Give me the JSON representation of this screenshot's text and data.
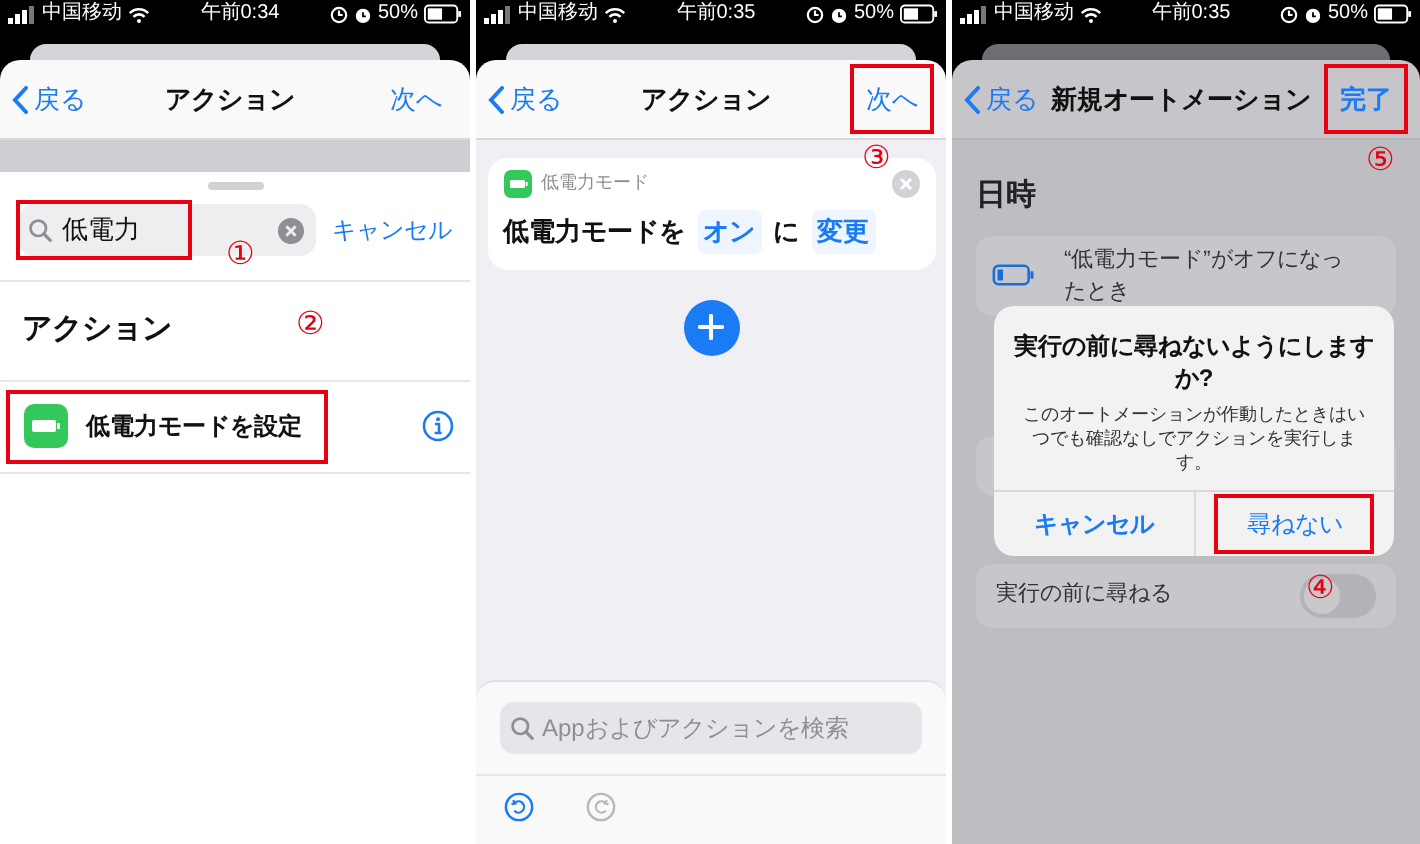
{
  "panels": [
    {
      "kind": "search",
      "status_bar": {
        "carrier": "中国移动",
        "time": "午前0:34",
        "battery": "50%"
      },
      "nav": {
        "back": "戻る",
        "title": "アクション",
        "next": "次へ",
        "highlighted": false
      },
      "search": {
        "value": "低電力",
        "highlighted": true,
        "cancel": "キャンセル"
      },
      "section": "アクション",
      "result": {
        "label": "低電力モードを設定",
        "highlighted": true
      },
      "callouts": [
        "①",
        "②"
      ]
    },
    {
      "kind": "editor",
      "status_bar": {
        "carrier": "中国移动",
        "time": "午前0:35",
        "battery": "50%"
      },
      "nav": {
        "back": "戻る",
        "title": "アクション",
        "next": "次へ",
        "highlighted": true
      },
      "card": {
        "app": "低電力モード",
        "parts": [
          {
            "kind": "text",
            "text": "低電力モードを"
          },
          {
            "kind": "token",
            "text": "オン"
          },
          {
            "kind": "text",
            "text": "に"
          },
          {
            "kind": "token",
            "text": "変更"
          }
        ]
      },
      "search": {
        "placeholder": "Appおよびアクションを検索"
      },
      "callouts": [
        "③"
      ]
    },
    {
      "kind": "automation",
      "status_bar": {
        "carrier": "中国移动",
        "time": "午前0:35",
        "battery": "50%"
      },
      "nav": {
        "back": "戻る",
        "title": "新規オートメーション",
        "next": "完了",
        "highlighted": true
      },
      "section": "日時",
      "trigger": "“低電力モード”がオフになったとき",
      "dialog": {
        "title": "実行の前に尋ねないようにしますか?",
        "message": "このオートメーションが作動したときはいつでも確認なしでアクションを実行します。",
        "buttons": [
          {
            "label": "キャンセル",
            "kind": "cancel",
            "highlighted": false
          },
          {
            "label": "尋ねない",
            "kind": "default",
            "highlighted": true
          }
        ]
      },
      "toggle": {
        "label": "実行の前に尋ねる",
        "on": false
      },
      "callouts": [
        "⑤",
        "④"
      ]
    }
  ]
}
